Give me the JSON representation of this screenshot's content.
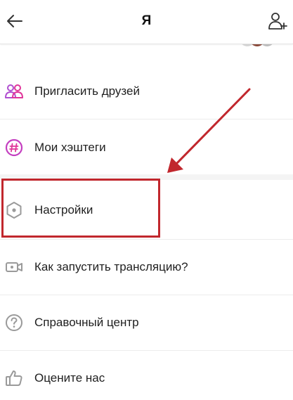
{
  "header": {
    "title": "Я",
    "back_icon": "arrow-left-icon",
    "add_friend_icon": "person-plus-icon"
  },
  "menu": {
    "items": [
      {
        "id": "invite",
        "label": "Пригласить друзей",
        "icon": "people-icon",
        "icon_color": "#b04fd0"
      },
      {
        "id": "hashtags",
        "label": "Мои хэштеги",
        "icon": "hashtag-icon",
        "icon_color": "#e0359a"
      },
      {
        "id": "settings",
        "label": "Настройки",
        "icon": "hexagon-gear-icon",
        "icon_color": "#9a9a9a"
      },
      {
        "id": "broadcast",
        "label": "Как запустить трансляцию?",
        "icon": "video-camera-icon",
        "icon_color": "#9a9a9a"
      },
      {
        "id": "help",
        "label": "Справочный центр",
        "icon": "question-circle-icon",
        "icon_color": "#9a9a9a"
      },
      {
        "id": "rate",
        "label": "Оцените нас",
        "icon": "thumbs-up-icon",
        "icon_color": "#9a9a9a"
      }
    ]
  },
  "annotation": {
    "highlight_color": "#c1272d",
    "highlighted_item": "settings"
  }
}
